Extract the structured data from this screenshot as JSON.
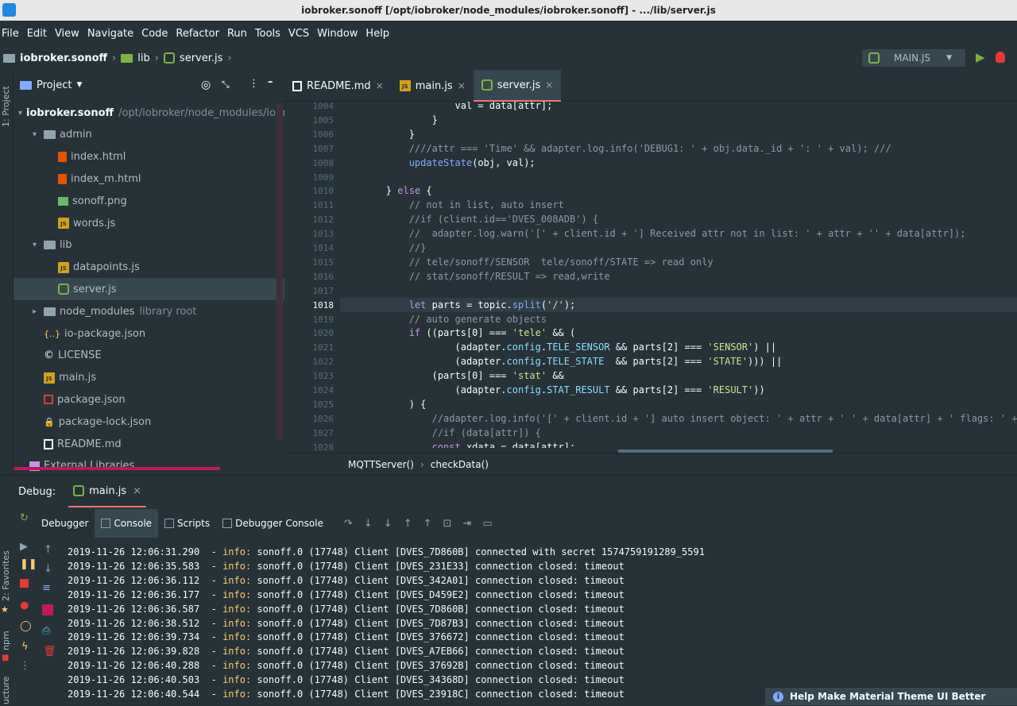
{
  "window": {
    "title": "iobroker.sonoff [/opt/iobroker/node_modules/iobroker.sonoff] - .../lib/server.js"
  },
  "menu": [
    "File",
    "Edit",
    "View",
    "Navigate",
    "Code",
    "Refactor",
    "Run",
    "Tools",
    "VCS",
    "Window",
    "Help"
  ],
  "breadcrumb": {
    "project": "iobroker.sonoff",
    "folder": "lib",
    "file": "server.js"
  },
  "run_config": {
    "label": "MAIN.JS"
  },
  "left_strip": {
    "project": "1: Project",
    "favorites": "2: Favorites",
    "npm": "npm",
    "structure": "ucture"
  },
  "project_panel": {
    "title": "Project",
    "tree": [
      {
        "label": "iobroker.sonoff",
        "extra": "/opt/iobroker/node_modules/iobr",
        "icon": "folder",
        "depth": 0,
        "arrow": "down"
      },
      {
        "label": "admin",
        "icon": "folder",
        "depth": 1,
        "arrow": "down"
      },
      {
        "label": "index.html",
        "icon": "html",
        "depth": 2
      },
      {
        "label": "index_m.html",
        "icon": "html",
        "depth": 2
      },
      {
        "label": "sonoff.png",
        "icon": "image",
        "depth": 2
      },
      {
        "label": "words.js",
        "icon": "js",
        "depth": 2
      },
      {
        "label": "lib",
        "icon": "folder",
        "depth": 1,
        "arrow": "down"
      },
      {
        "label": "datapoints.js",
        "icon": "js",
        "depth": 2
      },
      {
        "label": "server.js",
        "icon": "node",
        "depth": 2,
        "selected": true
      },
      {
        "label": "node_modules",
        "extra": "library root",
        "icon": "folder",
        "depth": 1,
        "arrow": "right"
      },
      {
        "label": "io-package.json",
        "icon": "json",
        "depth": 1
      },
      {
        "label": "LICENSE",
        "icon": "license",
        "depth": 1
      },
      {
        "label": "main.js",
        "icon": "js",
        "depth": 1
      },
      {
        "label": "package.json",
        "icon": "npm",
        "depth": 1
      },
      {
        "label": "package-lock.json",
        "icon": "lock",
        "depth": 1
      },
      {
        "label": "README.md",
        "icon": "md",
        "depth": 1
      },
      {
        "label": "External Libraries",
        "icon": "lib",
        "depth": 0
      }
    ]
  },
  "tabs": [
    {
      "label": "README.md",
      "icon": "md"
    },
    {
      "label": "main.js",
      "icon": "js"
    },
    {
      "label": "server.js",
      "icon": "node",
      "active": true
    }
  ],
  "code": {
    "lines": [
      {
        "n": "1004",
        "t": "                    val = data[attr];"
      },
      {
        "n": "1005",
        "t": "                }"
      },
      {
        "n": "1006",
        "t": "            }"
      },
      {
        "n": "1007",
        "t": "            ////attr === 'Time' && adapter.log.info('DEBUG1: ' + obj.data._id + ': ' + val); ///"
      },
      {
        "n": "1008",
        "t": "            updateState(obj, val);"
      },
      {
        "n": "1009",
        "t": ""
      },
      {
        "n": "1010",
        "t": "        } else {"
      },
      {
        "n": "1011",
        "t": "            // not in list, auto insert"
      },
      {
        "n": "1012",
        "t": "            //if (client.id=='DVES_008ADB') {"
      },
      {
        "n": "1013",
        "t": "            //  adapter.log.warn('[' + client.id + '] Received attr not in list: ' + attr + '' + data[attr]);"
      },
      {
        "n": "1014",
        "t": "            //}"
      },
      {
        "n": "1015",
        "t": "            // tele/sonoff/SENSOR  tele/sonoff/STATE => read only"
      },
      {
        "n": "1016",
        "t": "            // stat/sonoff/RESULT => read,write"
      },
      {
        "n": "1017",
        "t": ""
      },
      {
        "n": "1018",
        "t": "            let parts = topic.split('/');"
      },
      {
        "n": "1019",
        "t": "            // auto generate objects"
      },
      {
        "n": "1020",
        "t": "            if ((parts[0] === 'tele' && ("
      },
      {
        "n": "1021",
        "t": "                    (adapter.config.TELE_SENSOR && parts[2] === 'SENSOR') ||"
      },
      {
        "n": "1022",
        "t": "                    (adapter.config.TELE_STATE  && parts[2] === 'STATE'))) ||"
      },
      {
        "n": "1023",
        "t": "                (parts[0] === 'stat' &&"
      },
      {
        "n": "1024",
        "t": "                    (adapter.config.STAT_RESULT && parts[2] === 'RESULT'))"
      },
      {
        "n": "1025",
        "t": "            ) {"
      },
      {
        "n": "1026",
        "t": "                //adapter.log.info('[' + client.id + '] auto insert object: ' + attr + ' ' + data[attr] + ' flags: ' +"
      },
      {
        "n": "1027",
        "t": "                //if (data[attr]) {"
      },
      {
        "n": "1028",
        "t": "                const xdata = data[attr];"
      }
    ],
    "current_line": "1018"
  },
  "editor_breadcrumb": {
    "fn1": "MQTTServer()",
    "fn2": "checkData()"
  },
  "debug": {
    "label": "Debug:",
    "session": "main.js",
    "tabs": [
      "Debugger",
      "Console",
      "Scripts",
      "Debugger Console"
    ],
    "active_tab": "Console"
  },
  "console": {
    "lines": [
      {
        "ts": "2019-11-26 12:06:31.290",
        "lvl": "info:",
        "msg": " sonoff.0 (17748) Client [DVES_7D860B] connected with secret 1574759191289_5591"
      },
      {
        "ts": "2019-11-26 12:06:35.583",
        "lvl": "info:",
        "msg": " sonoff.0 (17748) Client [DVES_231E33] connection closed: timeout"
      },
      {
        "ts": "2019-11-26 12:06:36.112",
        "lvl": "info:",
        "msg": " sonoff.0 (17748) Client [DVES_342A01] connection closed: timeout"
      },
      {
        "ts": "2019-11-26 12:06:36.177",
        "lvl": "info:",
        "msg": " sonoff.0 (17748) Client [DVES_D459E2] connection closed: timeout"
      },
      {
        "ts": "2019-11-26 12:06:36.587",
        "lvl": "info:",
        "msg": " sonoff.0 (17748) Client [DVES_7D860B] connection closed: timeout"
      },
      {
        "ts": "2019-11-26 12:06:38.512",
        "lvl": "info:",
        "msg": " sonoff.0 (17748) Client [DVES_7D87B3] connection closed: timeout"
      },
      {
        "ts": "2019-11-26 12:06:39.734",
        "lvl": "info:",
        "msg": " sonoff.0 (17748) Client [DVES_376672] connection closed: timeout"
      },
      {
        "ts": "2019-11-26 12:06:39.828",
        "lvl": "info:",
        "msg": " sonoff.0 (17748) Client [DVES_A7EB66] connection closed: timeout"
      },
      {
        "ts": "2019-11-26 12:06:40.288",
        "lvl": "info:",
        "msg": " sonoff.0 (17748) Client [DVES_37692B] connection closed: timeout"
      },
      {
        "ts": "2019-11-26 12:06:40.503",
        "lvl": "info:",
        "msg": " sonoff.0 (17748) Client [DVES_34368D] connection closed: timeout"
      },
      {
        "ts": "2019-11-26 12:06:40.544",
        "lvl": "info:",
        "msg": " sonoff.0 (17748) Client [DVES_23918C] connection closed: timeout"
      }
    ]
  },
  "notification": {
    "text": "Help Make Material Theme UI Better"
  },
  "colors": {
    "bg": "#263238",
    "accent": "#f07178",
    "selection": "#37474f",
    "info": "#ffcb6b"
  }
}
